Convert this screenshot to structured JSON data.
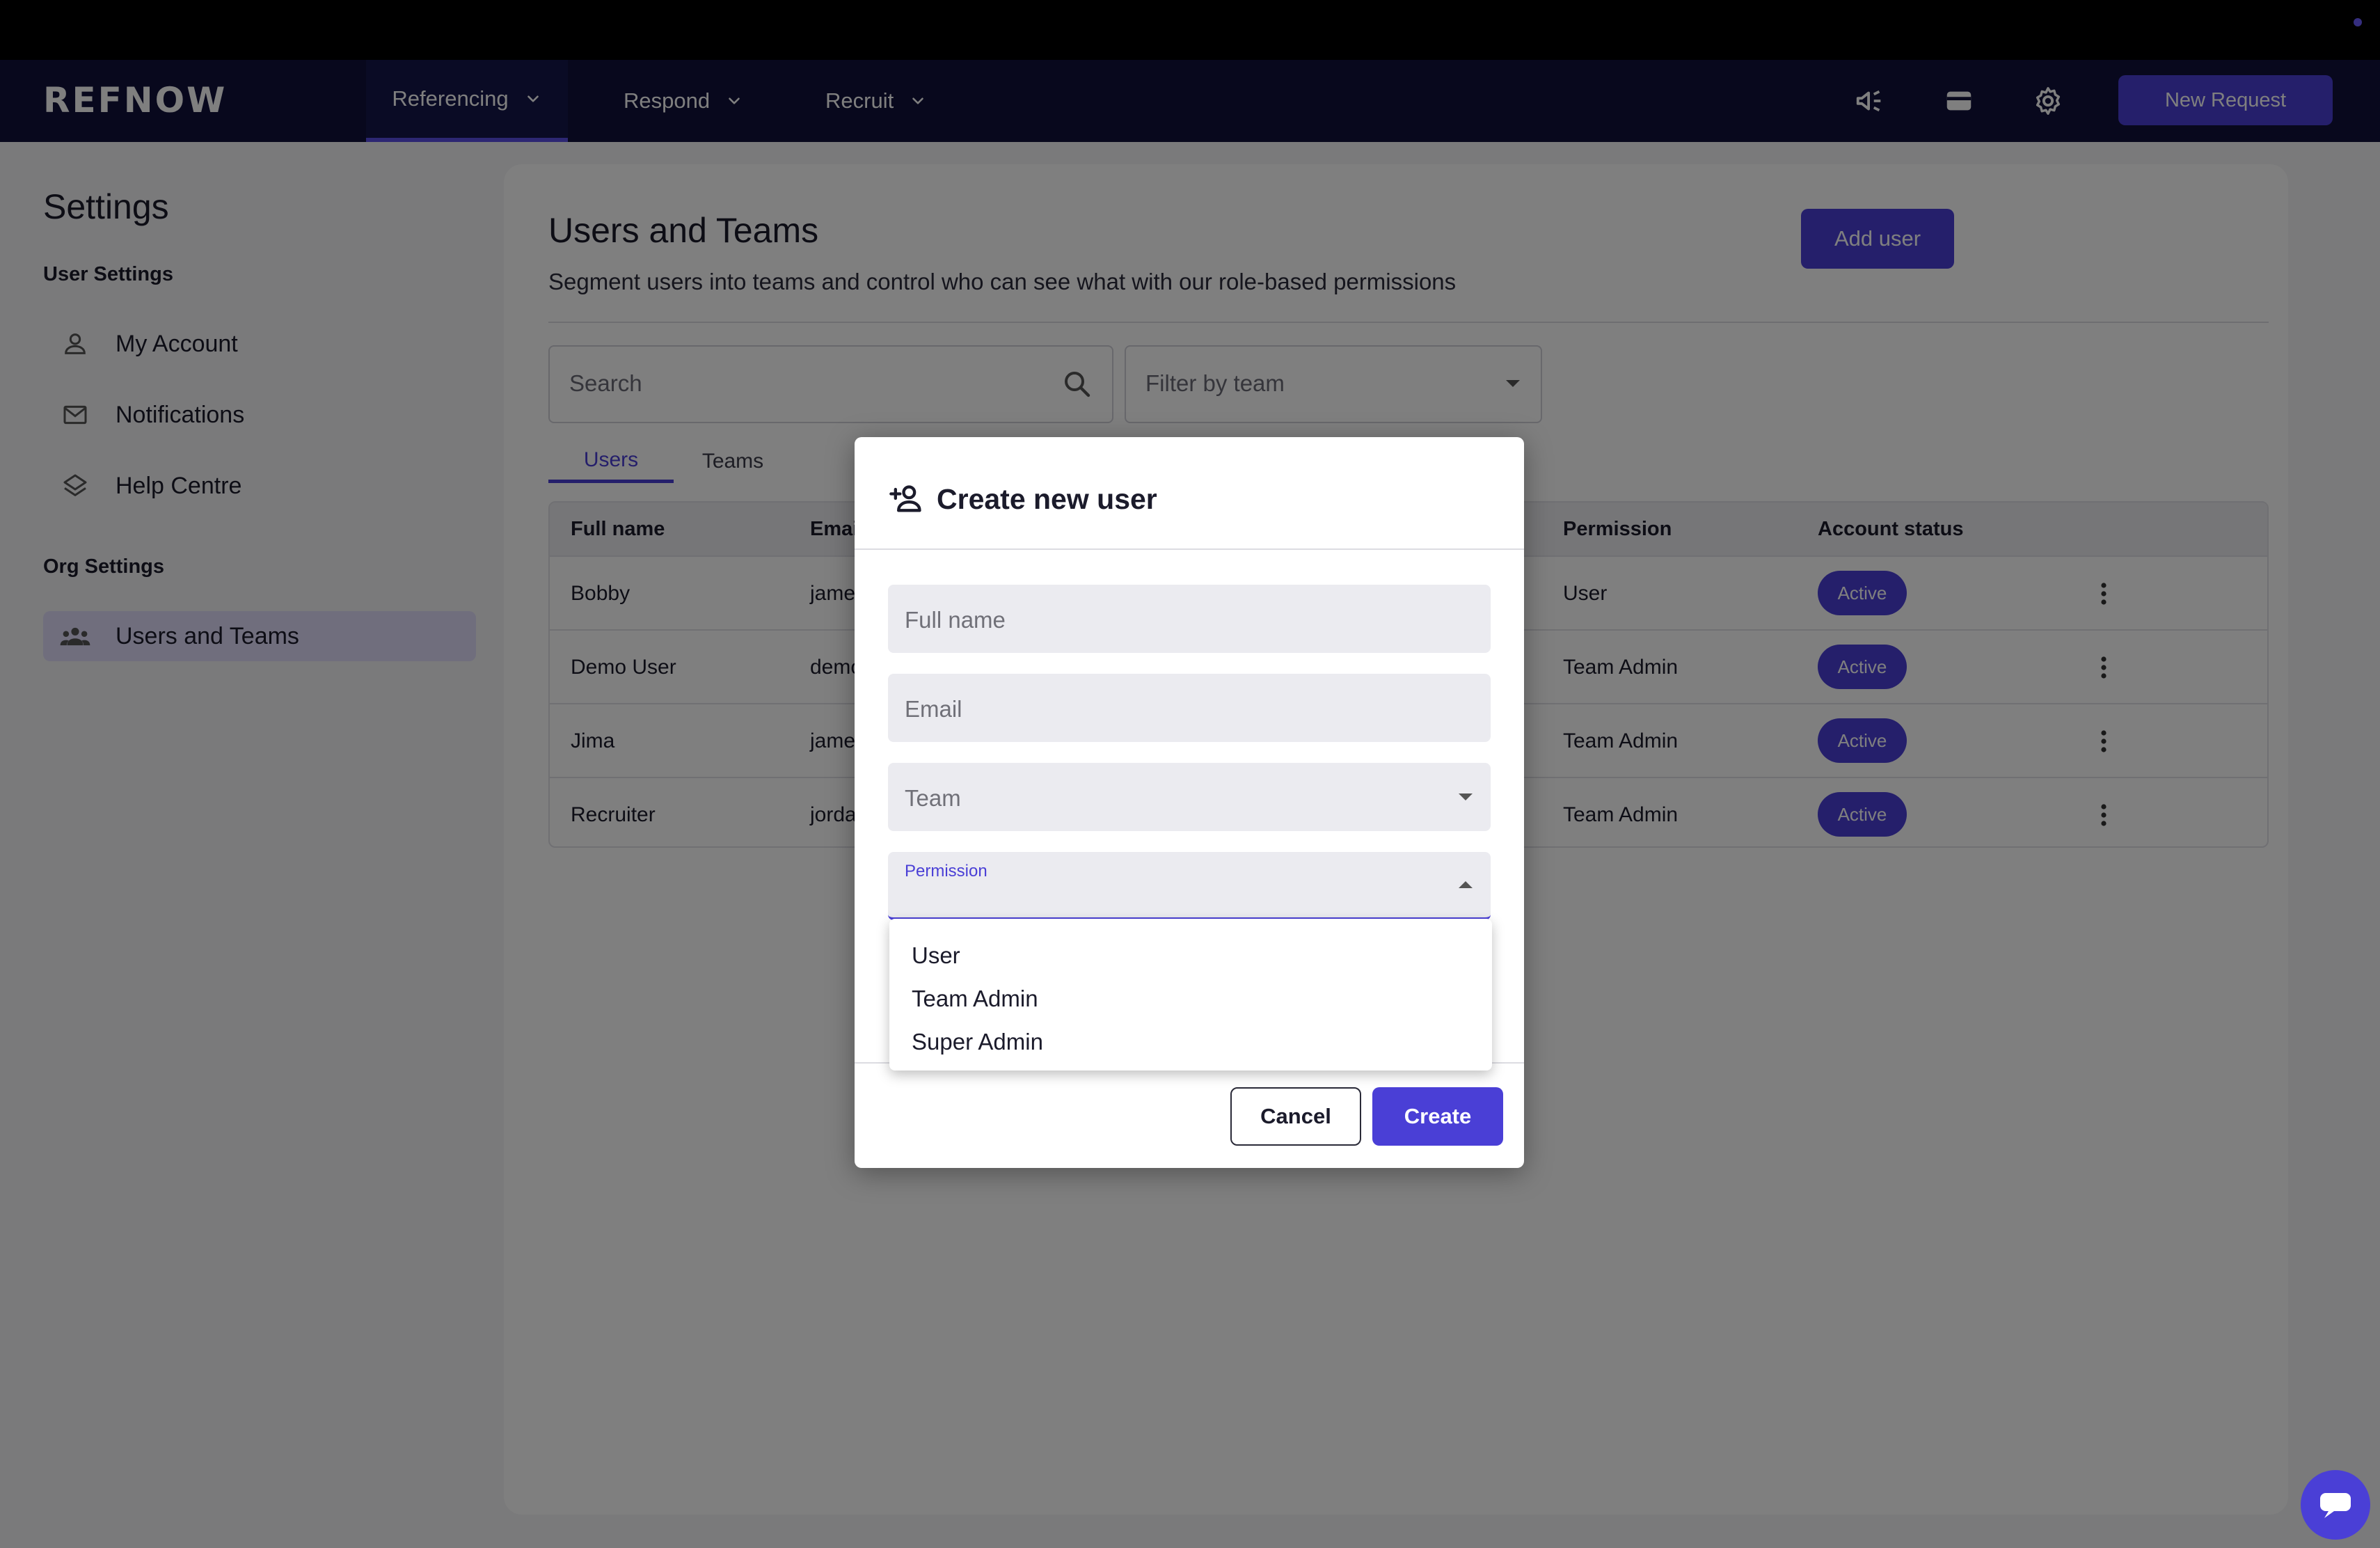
{
  "brand": {
    "logo_text": "REFNOW",
    "accent": "#4a3fd6",
    "nav_bg": "#10113a"
  },
  "nav": {
    "items": [
      {
        "label": "Referencing"
      },
      {
        "label": "Respond"
      },
      {
        "label": "Recruit"
      }
    ],
    "icons": [
      "megaphone-icon",
      "wallet-icon",
      "gear-icon"
    ],
    "new_request_label": "New Request"
  },
  "sidebar": {
    "title": "Settings",
    "user_section": "User Settings",
    "user_items": [
      {
        "label": "My Account",
        "icon": "person-icon"
      },
      {
        "label": "Notifications",
        "icon": "mail-icon"
      },
      {
        "label": "Help Centre",
        "icon": "layers-icon"
      }
    ],
    "org_section": "Org Settings",
    "org_items": [
      {
        "label": "Users and Teams",
        "icon": "group-icon"
      }
    ]
  },
  "main": {
    "title": "Users and Teams",
    "subtitle": "Segment users into teams and control who can see what with our role-based permissions",
    "add_user_label": "Add user",
    "search_placeholder": "Search",
    "filter_placeholder": "Filter by team",
    "tabs": [
      {
        "label": "Users"
      },
      {
        "label": "Teams"
      }
    ],
    "table": {
      "headers": [
        "Full name",
        "Emai",
        "Permission",
        "Account status"
      ],
      "rows": [
        {
          "name": "Bobby",
          "email": "james",
          "permission": "User",
          "status": "Active"
        },
        {
          "name": "Demo User",
          "email": "demo",
          "permission": "Team Admin",
          "status": "Active"
        },
        {
          "name": "Jima",
          "email": "james",
          "permission": "Team Admin",
          "status": "Active"
        },
        {
          "name": "Recruiter",
          "email": "jorda",
          "permission": "Team Admin",
          "status": "Active"
        }
      ]
    }
  },
  "modal": {
    "title": "Create new user",
    "fields": {
      "full_name_placeholder": "Full name",
      "email_placeholder": "Email",
      "team_placeholder": "Team",
      "permission_label": "Permission"
    },
    "permission_options": [
      "User",
      "Team Admin",
      "Super Admin"
    ],
    "cancel_label": "Cancel",
    "create_label": "Create"
  }
}
